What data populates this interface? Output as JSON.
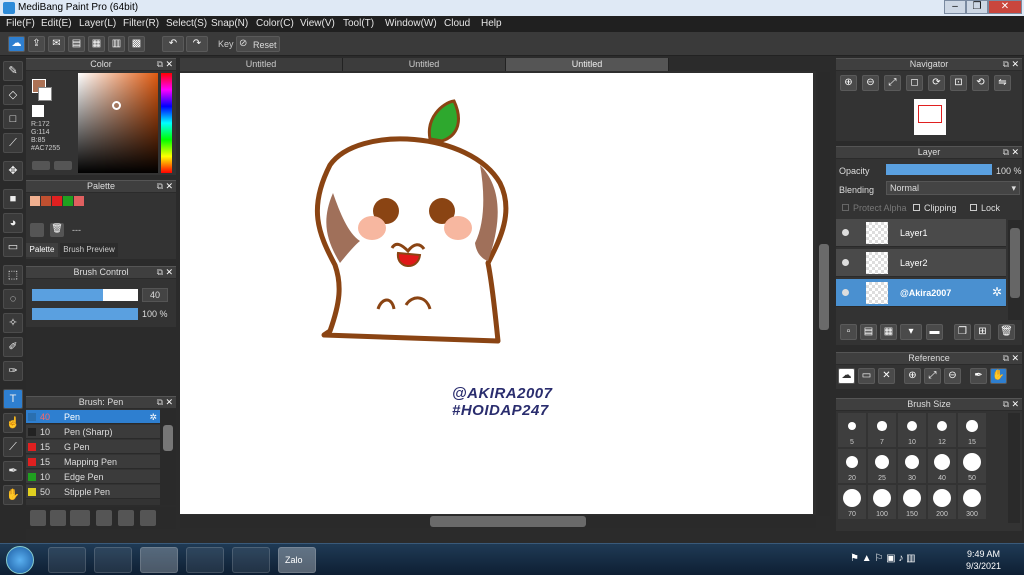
{
  "window": {
    "title": "MediBang Paint Pro (64bit)"
  },
  "menu": [
    "File(F)",
    "Edit(E)",
    "Layer(L)",
    "Filter(R)",
    "Select(S)",
    "Snap(N)",
    "Color(C)",
    "View(V)",
    "Tool(T)",
    "Window(W)",
    "Cloud",
    "Help"
  ],
  "toolbar": {
    "key_label": "Key",
    "reset_label": "Reset"
  },
  "tabs": [
    "Untitled",
    "Untitled",
    "Untitled"
  ],
  "color_panel": {
    "title": "Color",
    "r": "R:172",
    "g": "G:114",
    "b": "B:85",
    "hex": "#AC7255",
    "fg": "#ac7255"
  },
  "palette_panel": {
    "title": "Palette",
    "swatches": [
      "#f0b090",
      "#c05030",
      "#e02020",
      "#20a020",
      "#e06060"
    ],
    "row_label": "---",
    "tab_palette": "Palette",
    "tab_preview": "Brush Preview"
  },
  "brush_control": {
    "title": "Brush Control",
    "size": "40",
    "opacity": "100 %",
    "size_fraction": 0.67,
    "opacity_fraction": 1.0
  },
  "brush_panel": {
    "title": "Brush: Pen",
    "items": [
      {
        "size": "40",
        "name": "Pen",
        "color": "#2a6fb0",
        "selected": true
      },
      {
        "size": "10",
        "name": "Pen (Sharp)",
        "color": "#222"
      },
      {
        "size": "15",
        "name": "G Pen",
        "color": "#e02020"
      },
      {
        "size": "15",
        "name": "Mapping Pen",
        "color": "#e02020"
      },
      {
        "size": "10",
        "name": "Edge Pen",
        "color": "#20a020"
      },
      {
        "size": "50",
        "name": "Stipple Pen",
        "color": "#e0d020"
      }
    ]
  },
  "canvas_text": {
    "line1": "@AKIRA2007",
    "line2": "#HOIDAP247"
  },
  "navigator": {
    "title": "Navigator"
  },
  "layer_panel": {
    "title": "Layer",
    "opacity_label": "Opacity",
    "opacity_value": "100 %",
    "blending_label": "Blending",
    "blending_value": "Normal",
    "protect_alpha": "Protect Alpha",
    "clipping": "Clipping",
    "lock": "Lock",
    "layers": [
      {
        "name": "Layer1",
        "selected": false
      },
      {
        "name": "Layer2",
        "selected": false
      },
      {
        "name": "@Akira2007",
        "selected": true
      }
    ]
  },
  "reference": {
    "title": "Reference"
  },
  "brush_size": {
    "title": "Brush Size",
    "sizes": [
      "5",
      "7",
      "10",
      "12",
      "15",
      "20",
      "25",
      "30",
      "40",
      "50",
      "70",
      "100",
      "150",
      "200",
      "300"
    ]
  },
  "taskbar": {
    "time": "9:49 AM",
    "date": "9/3/2021",
    "zalo": "Zalo"
  }
}
